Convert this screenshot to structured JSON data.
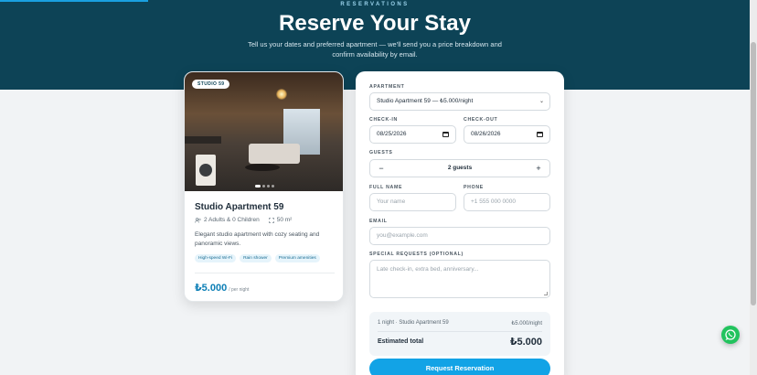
{
  "hero": {
    "eyebrow": "RESERVATIONS",
    "title": "Reserve Your Stay",
    "subtitle": "Tell us your dates and preferred apartment — we'll send you a price breakdown and confirm availability by email."
  },
  "colors": {
    "hero_bg": "#0d4356",
    "accent": "#12a3e6",
    "whatsapp": "#22c35e"
  },
  "apartment_card": {
    "badge": "STUDIO 59",
    "title": "Studio Apartment 59",
    "guests": "2 Adults & 0 Children",
    "area": "50 m²",
    "description": "Elegant studio apartment with cozy seating and panoramic views.",
    "tags": [
      "High-speed Wi-Fi",
      "Rain shower",
      "Premium amenities"
    ],
    "price": "₺5.000",
    "price_unit": "/ per night",
    "carousel": {
      "count": 4,
      "active": 1
    }
  },
  "form": {
    "apartment_label": "APARTMENT",
    "apartment_value": "Studio Apartment 59 — ₺5.000/night",
    "checkin_label": "CHECK-IN",
    "checkin_value": "08/25/2026",
    "checkout_label": "CHECK-OUT",
    "checkout_value": "08/26/2026",
    "guests_label": "GUESTS",
    "guests_value": "2 guests",
    "minus": "−",
    "plus": "+",
    "fullname_label": "FULL NAME",
    "fullname_placeholder": "Your name",
    "phone_label": "PHONE",
    "phone_placeholder": "+1 555 000 0000",
    "email_label": "EMAIL",
    "email_placeholder": "you@example.com",
    "requests_label": "SPECIAL REQUESTS (OPTIONAL)",
    "requests_placeholder": "Late check-in, extra bed, anniversary...",
    "summary_line": "1 night · Studio Apartment 59",
    "summary_rate": "₺5.000/night",
    "estimated_label": "Estimated total",
    "estimated_value": "₺5.000",
    "submit_label": "Request Reservation"
  }
}
